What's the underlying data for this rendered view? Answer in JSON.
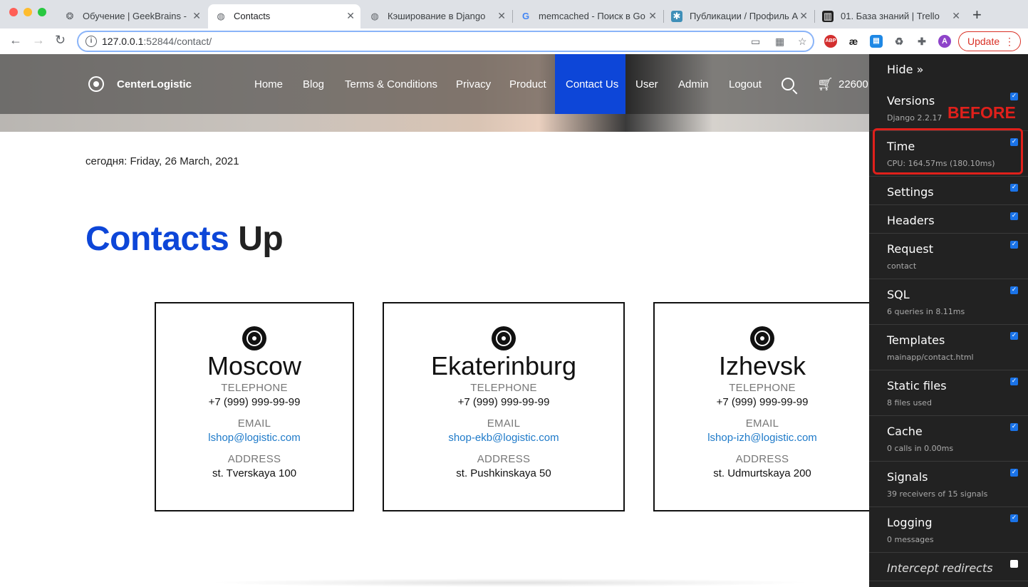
{
  "browser": {
    "tabs": [
      {
        "title": "Обучение | GeekBrains - ",
        "favicon": "geekbrains-icon"
      },
      {
        "title": "Contacts",
        "favicon": "globe-icon"
      },
      {
        "title": "Кэширование в Django",
        "favicon": "globe-icon"
      },
      {
        "title": "memcached - Поиск в Go",
        "favicon": "google-icon"
      },
      {
        "title": "Публикации / Профиль A",
        "favicon": "habr-icon"
      },
      {
        "title": "01. База знаний | Trello",
        "favicon": "trello-icon"
      }
    ],
    "url_host": "127.0.0.1",
    "url_rest": ":52844/contact/",
    "update_label": "Update",
    "avatar_letter": "A",
    "ext_abp": "ABP",
    "ext_ae": "æ"
  },
  "site": {
    "logo": "CenterLogistic",
    "nav": [
      "Home",
      "Blog",
      "Terms & Conditions",
      "Privacy",
      "Product",
      "Contact Us",
      "User",
      "Admin",
      "Logout"
    ],
    "active_nav": "Contact Us",
    "cart_count": "22600",
    "today": "сегодня: Friday, 26 March, 2021",
    "heading_blue": "Contacts",
    "heading_rest": "Up",
    "cards": [
      {
        "city": "Moscow",
        "tel_label": "TELEPHONE",
        "tel": "+7 (999) 999-99-99",
        "email_label": "EMAIL",
        "email": "lshop@logistic.com",
        "addr_label": "ADDRESS",
        "addr": "st. Tverskaya 100"
      },
      {
        "city": "Ekaterinburg",
        "tel_label": "TELEPHONE",
        "tel": "+7 (999) 999-99-99",
        "email_label": "EMAIL",
        "email": "shop-ekb@logistic.com",
        "addr_label": "ADDRESS",
        "addr": "st. Pushkinskaya 50"
      },
      {
        "city": "Izhevsk",
        "tel_label": "TELEPHONE",
        "tel": "+7 (999) 999-99-99",
        "email_label": "EMAIL",
        "email": "lshop-izh@logistic.com",
        "addr_label": "ADDRESS",
        "addr": "st. Udmurtskaya 200"
      }
    ]
  },
  "debug_toolbar": {
    "hide_label": "Hide »",
    "panels": [
      {
        "title": "Versions",
        "sub": "Django 2.2.17",
        "checked": true
      },
      {
        "title": "Time",
        "sub": "CPU: 164.57ms (180.10ms)",
        "checked": true
      },
      {
        "title": "Settings",
        "sub": "",
        "checked": true
      },
      {
        "title": "Headers",
        "sub": "",
        "checked": true
      },
      {
        "title": "Request",
        "sub": "contact",
        "checked": true
      },
      {
        "title": "SQL",
        "sub": "6 queries in 8.11ms",
        "checked": true
      },
      {
        "title": "Templates",
        "sub": "mainapp/contact.html",
        "checked": true
      },
      {
        "title": "Static files",
        "sub": "8 files used",
        "checked": true
      },
      {
        "title": "Cache",
        "sub": "0 calls in 0.00ms",
        "checked": true
      },
      {
        "title": "Signals",
        "sub": "39 receivers of 15 signals",
        "checked": true
      },
      {
        "title": "Logging",
        "sub": "0 messages",
        "checked": true
      },
      {
        "title": "Intercept redirects",
        "sub": "",
        "checked": false
      }
    ]
  },
  "annotation": {
    "before_label": "BEFORE"
  },
  "colors": {
    "accent_blue": "#0d46d8",
    "link_blue": "#1e7ac9",
    "annotation_red": "#e0201b",
    "toolbar_bg": "#222222"
  }
}
